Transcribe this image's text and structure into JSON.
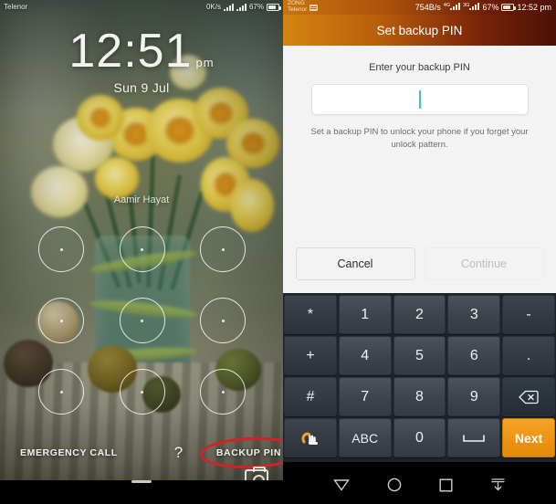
{
  "lock_screen": {
    "status_bar": {
      "carrier": "Telenor",
      "network_speed": "0K/s",
      "battery_percent": "67%",
      "signal_icon": "signal-bars-icon",
      "battery_icon": "battery-icon"
    },
    "clock": {
      "time": "12:51",
      "ampm": "pm",
      "date": "Sun 9 Jul"
    },
    "owner_name": "Aamir Hayat",
    "pattern_lock": {
      "name": "pattern-lock-grid",
      "rows": 3,
      "cols": 3,
      "dot_count": 9
    },
    "bottom_bar": {
      "emergency_call": "EMERGENCY CALL",
      "help": "?",
      "backup_pin": "BACKUP PIN",
      "camera_icon": "camera-icon"
    },
    "annotation": {
      "shape": "ellipse",
      "color": "#d81f26",
      "target": "BACKUP PIN"
    }
  },
  "pin_screen": {
    "status_bar": {
      "carrier_1": "ZONG",
      "carrier_2": "Telenor",
      "sim_icon": "sim-card-icon",
      "network_speed": "754B/s",
      "signal_1_label": "4G",
      "signal_2_label": "3G",
      "battery_percent": "67%",
      "battery_icon": "battery-icon",
      "clock": "12:52 pm"
    },
    "header": {
      "title": "Set backup PIN"
    },
    "body": {
      "field_label": "Enter your backup PIN",
      "input_value": "",
      "input_placeholder": "",
      "caret_color": "#37c3c9",
      "hint": "Set a backup PIN to unlock your phone if you forget your unlock pattern."
    },
    "buttons": {
      "cancel": "Cancel",
      "continue": "Continue"
    },
    "keyboard": {
      "row1": [
        "*",
        "1",
        "2",
        "3",
        "-"
      ],
      "row2": [
        "+",
        "4",
        "5",
        "6",
        "."
      ],
      "row3": [
        "#",
        "7",
        "8",
        "9",
        "backspace-icon"
      ],
      "row4_swipe_icon": "swipe-input-icon",
      "row4_abc": "ABC",
      "row4_zero": "0",
      "row4_space_icon": "space-bar-icon",
      "row4_next": "Next",
      "next_key_color": "#ee9312"
    },
    "nav_bar": {
      "back_icon": "back-triangle-icon",
      "home_icon": "home-circle-icon",
      "recents_icon": "recents-square-icon",
      "hide_keyboard_icon": "hide-keyboard-icon"
    }
  }
}
